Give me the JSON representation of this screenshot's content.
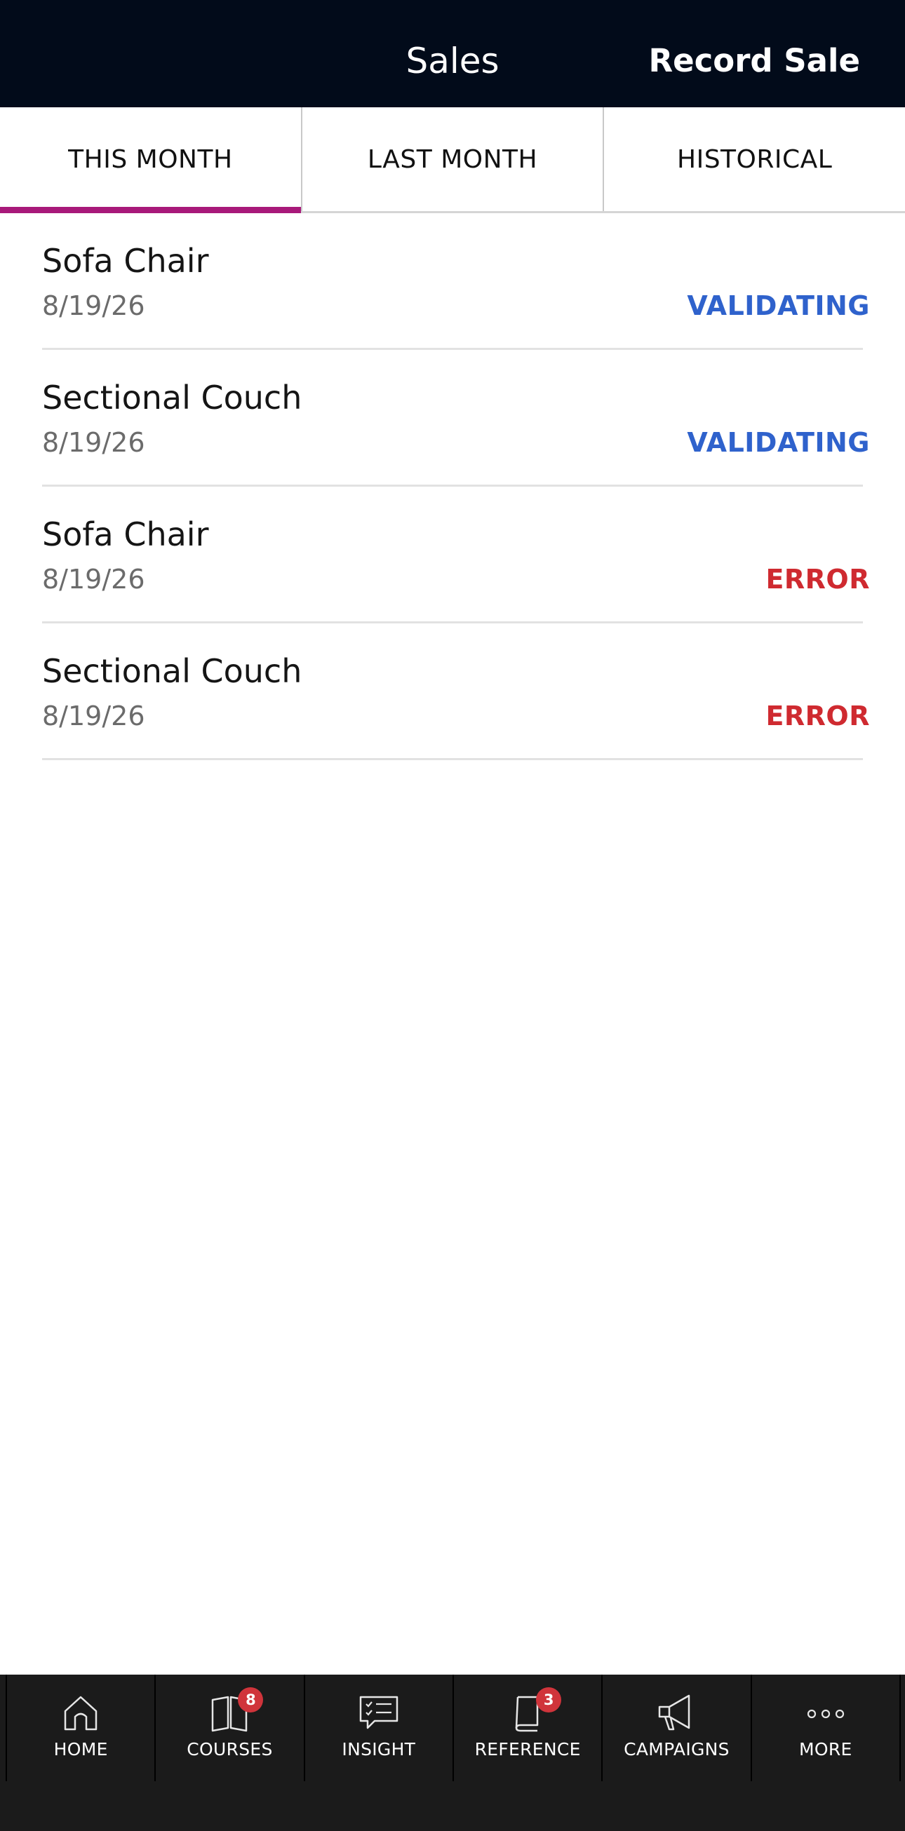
{
  "header": {
    "title": "Sales",
    "action_label": "Record Sale"
  },
  "tabs": [
    {
      "label": "THIS MONTH",
      "active": true
    },
    {
      "label": "LAST MONTH",
      "active": false
    },
    {
      "label": "HISTORICAL",
      "active": false
    }
  ],
  "sales": [
    {
      "title": "Sofa Chair",
      "date": "8/19/26",
      "status": "VALIDATING",
      "status_color": "#2f62cc"
    },
    {
      "title": "Sectional Couch",
      "date": "8/19/26",
      "status": "VALIDATING",
      "status_color": "#2f62cc"
    },
    {
      "title": "Sofa Chair",
      "date": "8/19/26",
      "status": "ERROR",
      "status_color": "#cf2a30"
    },
    {
      "title": "Sectional Couch",
      "date": "8/19/26",
      "status": "ERROR",
      "status_color": "#cf2a30"
    }
  ],
  "bottom_nav": [
    {
      "label": "HOME",
      "icon": "home-icon",
      "badge": ""
    },
    {
      "label": "COURSES",
      "icon": "open-book-icon",
      "badge": "8"
    },
    {
      "label": "INSIGHT",
      "icon": "chat-checklist-icon",
      "badge": ""
    },
    {
      "label": "REFERENCE",
      "icon": "reference-book-icon",
      "badge": "3"
    },
    {
      "label": "CAMPAIGNS",
      "icon": "megaphone-icon",
      "badge": ""
    },
    {
      "label": "MORE",
      "icon": "more-dots-icon",
      "badge": ""
    }
  ],
  "colors": {
    "header_bg": "#020b1a",
    "tab_indicator": "#a8197a",
    "validating": "#2f62cc",
    "error": "#cf2a30",
    "nav_bg": "#1b1b1b",
    "badge": "#d0343b"
  }
}
